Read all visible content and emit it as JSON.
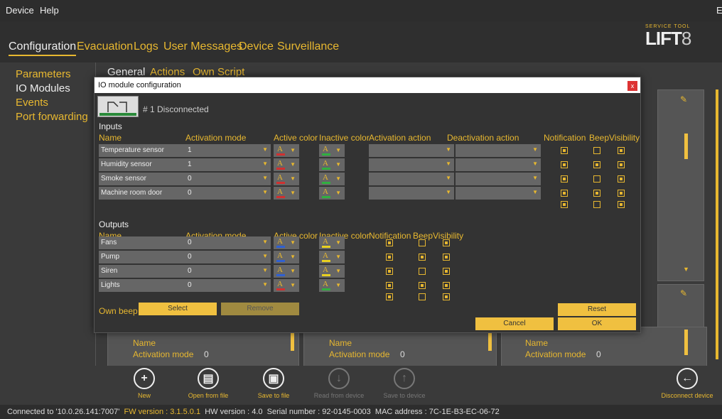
{
  "menu": {
    "device": "Device",
    "help": "Help",
    "right_fragment": "E"
  },
  "nav": {
    "tabs": [
      "Configuration",
      "Evacuation",
      "Logs",
      "User Messages",
      "Device",
      "Surveillance"
    ],
    "active": 0
  },
  "logo": {
    "line1": "SERVICE TOOL",
    "brand": "LIFT",
    "num": "8"
  },
  "left_menu": [
    "Parameters",
    "IO Modules",
    "Events",
    "Port forwarding"
  ],
  "subtabs": [
    "General",
    "Actions",
    "Own Script"
  ],
  "bg_cards": {
    "name_label": "Name",
    "activation_label": "Activation mode",
    "activation_value": "0",
    "inputs_fragment": "Inputs"
  },
  "toolbar": [
    {
      "label": "New",
      "icon": "+",
      "enabled": true
    },
    {
      "label": "Open from file",
      "icon": "▤",
      "enabled": true
    },
    {
      "label": "Save to file",
      "icon": "▣",
      "enabled": true
    },
    {
      "label": "Read from device",
      "icon": "↓",
      "enabled": false
    },
    {
      "label": "Save to device",
      "icon": "↑",
      "enabled": false
    },
    {
      "label": "Disconnect device",
      "icon": "←",
      "enabled": true
    }
  ],
  "status": {
    "connected": "Connected to '10.0.26.141:7007'",
    "fw": "FW version : 3.1.5.0.1",
    "hw": "HW version : 4.0",
    "serial": "Serial number : 92-0145-0003",
    "mac": "MAC address : 7C-1E-B3-EC-06-72"
  },
  "dialog": {
    "title": "IO module configuration",
    "close": "x",
    "module_status": "# 1 Disconnected",
    "inputs_label": "Inputs",
    "outputs_label": "Outputs",
    "input_headers": {
      "name": "Name",
      "mode": "Activation mode",
      "active": "Active color",
      "inactive": "Inactive color",
      "act": "Activation action",
      "deact": "Deactivation action",
      "notif": "Notification",
      "beep": "Beep",
      "vis": "Visibility"
    },
    "output_headers": {
      "name": "Name",
      "mode": "Activation mode",
      "active": "Active color",
      "inactive": "Inactive color",
      "notif": "Notification",
      "beep": "Beep",
      "vis": "Visibility"
    },
    "inputs": [
      {
        "name": "Temperature sensor",
        "mode": "1",
        "active_color": "#d03030",
        "inactive_color": "#30b040",
        "notif": true,
        "beep": false,
        "vis": true
      },
      {
        "name": "Humidity sensor",
        "mode": "1",
        "active_color": "#d03030",
        "inactive_color": "#30b040",
        "notif": true,
        "beep": true,
        "vis": true
      },
      {
        "name": "Smoke sensor",
        "mode": "0",
        "active_color": "#d03030",
        "inactive_color": "#30b040",
        "notif": true,
        "beep": false,
        "vis": true
      },
      {
        "name": "Machine room door",
        "mode": "0",
        "active_color": "#d03030",
        "inactive_color": "#30b040",
        "notif": true,
        "beep": true,
        "vis": true
      }
    ],
    "inputs_extra": {
      "notif": true,
      "beep": false,
      "vis": true
    },
    "outputs": [
      {
        "name": "Fans",
        "mode": "0",
        "active_color": "#3060d0",
        "inactive_color": "#e8d020",
        "notif": true,
        "beep": false,
        "vis": true
      },
      {
        "name": "Pump",
        "mode": "0",
        "active_color": "#3060d0",
        "inactive_color": "#e8d020",
        "notif": true,
        "beep": true,
        "vis": true
      },
      {
        "name": "Siren",
        "mode": "0",
        "active_color": "#3060d0",
        "inactive_color": "#e8d020",
        "notif": true,
        "beep": false,
        "vis": true
      },
      {
        "name": "Lights",
        "mode": "0",
        "active_color": "#d03030",
        "inactive_color": "#30b040",
        "notif": true,
        "beep": true,
        "vis": true
      }
    ],
    "outputs_extra": {
      "notif": true,
      "beep": false,
      "vis": true
    },
    "own_beep": "Own beep",
    "select": "Select",
    "remove": "Remove",
    "reset": "Reset",
    "cancel": "Cancel",
    "ok": "OK"
  }
}
